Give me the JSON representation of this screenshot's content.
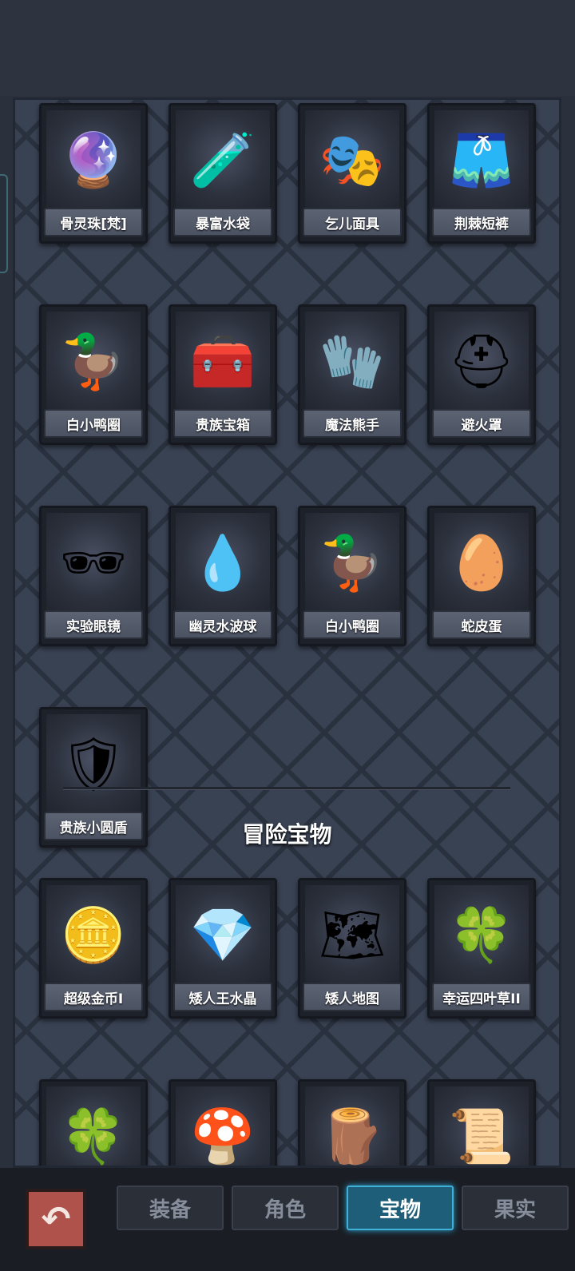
{
  "items": [
    {
      "name": "骨灵珠[梵]",
      "icon": "🔮"
    },
    {
      "name": "暴富水袋",
      "icon": "🧪"
    },
    {
      "name": "乞儿面具",
      "icon": "🎭"
    },
    {
      "name": "荆棘短裤",
      "icon": "🩳"
    },
    {
      "name": "白小鸭圈",
      "icon": "🦆"
    },
    {
      "name": "贵族宝箱",
      "icon": "🧰"
    },
    {
      "name": "魔法熊手",
      "icon": "🧤"
    },
    {
      "name": "避火罩",
      "icon": "⛑"
    },
    {
      "name": "实验眼镜",
      "icon": "🕶"
    },
    {
      "name": "幽灵水波球",
      "icon": "💧"
    },
    {
      "name": "白小鸭圈",
      "icon": "🦆"
    },
    {
      "name": "蛇皮蛋",
      "icon": "🥚"
    },
    {
      "name": "贵族小圆盾",
      "icon": "🛡"
    }
  ],
  "section_title": "冒险宝物",
  "adventure_items": [
    {
      "name": "超级金币I",
      "icon": "🪙"
    },
    {
      "name": "矮人王水晶",
      "icon": "💎"
    },
    {
      "name": "矮人地图",
      "icon": "🗺"
    },
    {
      "name": "幸运四叶草II",
      "icon": "🍀"
    },
    {
      "name": "",
      "icon": "🍀"
    },
    {
      "name": "",
      "icon": "🍄"
    },
    {
      "name": "",
      "icon": "🪵"
    },
    {
      "name": "",
      "icon": "📜"
    }
  ],
  "nav": {
    "back_icon": "↶",
    "tabs": [
      {
        "label": "装备"
      },
      {
        "label": "角色"
      },
      {
        "label": "宝物"
      },
      {
        "label": "果实"
      }
    ],
    "active_tab": "宝物"
  }
}
